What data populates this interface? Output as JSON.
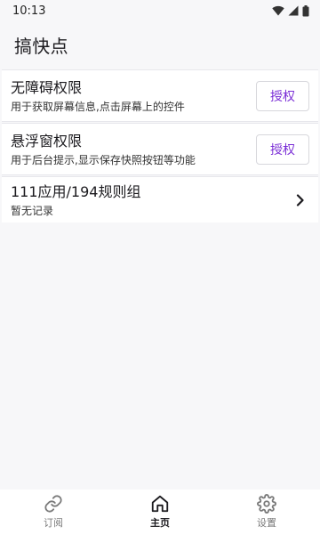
{
  "status_bar": {
    "time": "10:13",
    "icons": [
      "wifi-icon",
      "signal-icon",
      "battery-icon"
    ]
  },
  "header": {
    "title": "搞快点"
  },
  "permissions": [
    {
      "title": "无障碍权限",
      "desc": "用于获取屏幕信息,点击屏幕上的控件",
      "button": "授权"
    },
    {
      "title": "悬浮窗权限",
      "desc": "用于后台提示,显示保存快照按钮等功能",
      "button": "授权"
    }
  ],
  "rules": {
    "title": "111应用/194规则组",
    "subtitle": "暂无记录"
  },
  "bottom_nav": [
    {
      "label": "订阅",
      "icon": "link-icon",
      "active": false
    },
    {
      "label": "主页",
      "icon": "home-icon",
      "active": true
    },
    {
      "label": "设置",
      "icon": "gear-icon",
      "active": false
    }
  ],
  "colors": {
    "accent": "#7b2fd6",
    "background": "#f7f7f9"
  }
}
